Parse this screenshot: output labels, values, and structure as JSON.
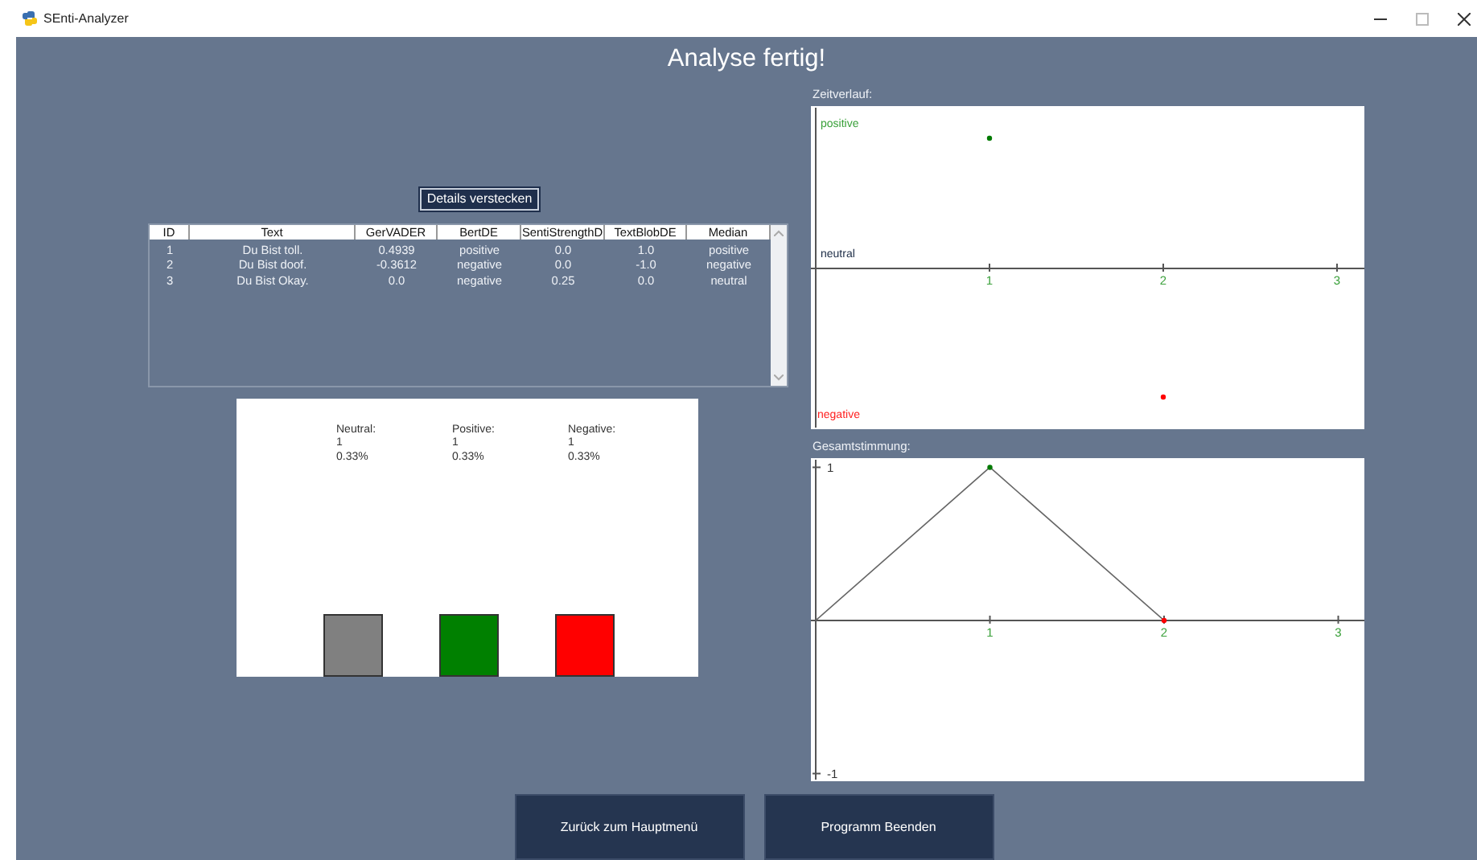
{
  "window": {
    "title": "SEnti-Analyzer"
  },
  "heading": "Analyse fertig!",
  "details_button": "Details verstecken",
  "table": {
    "columns": [
      "ID",
      "Text",
      "GerVADER",
      "BertDE",
      "SentiStrengthD",
      "TextBlobDE",
      "Median"
    ],
    "rows": [
      [
        "1",
        "Du Bist toll.",
        "0.4939",
        "positive",
        "0.0",
        "1.0",
        "positive"
      ],
      [
        "2",
        "Du Bist doof.",
        "-0.3612",
        "negative",
        "0.0",
        "-1.0",
        "negative"
      ],
      [
        "3",
        "Du Bist Okay.",
        "0.0",
        "negative",
        "0.25",
        "0.0",
        "neutral"
      ]
    ]
  },
  "summary": [
    {
      "label": "Neutral:",
      "count": "1",
      "share": "0.33%",
      "color": "#808080"
    },
    {
      "label": "Positive:",
      "count": "1",
      "share": "0.33%",
      "color": "#008000"
    },
    {
      "label": "Negative:",
      "count": "1",
      "share": "0.33%",
      "color": "#ff0000"
    }
  ],
  "timeline": {
    "label": "Zeitverlauf:",
    "levels": [
      {
        "label": "positive",
        "color": "#3aa03a"
      },
      {
        "label": "neutral",
        "color": "#1a2a44"
      },
      {
        "label": "negative",
        "color": "#ff2020"
      }
    ],
    "x_labels": [
      "1",
      "2",
      "3"
    ]
  },
  "overall": {
    "label": "Gesamtstimmung:",
    "chart_data": {
      "type": "line",
      "x": [
        0,
        1,
        2
      ],
      "series": [
        {
          "values": [
            0,
            1,
            0
          ]
        }
      ],
      "xlim": [
        0,
        3.15
      ],
      "ylim": [
        -1.05,
        1.06
      ],
      "xticks": [
        1,
        2,
        3
      ],
      "yticks": [
        1,
        -1
      ]
    }
  },
  "buttons": [
    "Zurück zum Hauptmenü",
    "Programm Beenden"
  ]
}
